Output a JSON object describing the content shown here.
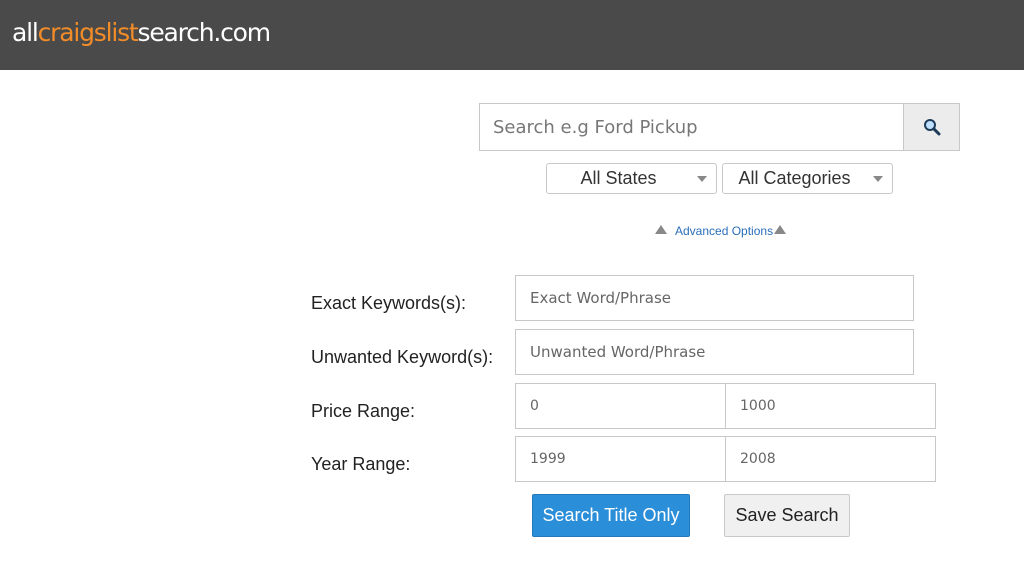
{
  "header": {
    "logo": {
      "part1": "all",
      "part2": "craigslist",
      "part3": "search.com"
    }
  },
  "search": {
    "placeholder": "Search e.g Ford Pickup",
    "button_icon": "magnifier-icon"
  },
  "filters": {
    "states": {
      "selected": "All States"
    },
    "categories": {
      "selected": "All Categories"
    }
  },
  "advanced": {
    "label": "Advanced Options",
    "icon": "triangle-up-icon"
  },
  "form": {
    "exact": {
      "label": "Exact Keywords(s):",
      "placeholder": "Exact Word/Phrase"
    },
    "unwanted": {
      "label": "Unwanted Keyword(s):",
      "placeholder": "Unwanted Word/Phrase"
    },
    "price": {
      "label": "Price Range:",
      "min": "0",
      "max": "1000"
    },
    "year": {
      "label": "Year Range:",
      "min": "1999",
      "max": "2008"
    }
  },
  "actions": {
    "search_title_only": "Search Title Only",
    "save_search": "Save Search"
  },
  "colors": {
    "header_bg": "#4a4a4a",
    "logo_accent": "#f28c28",
    "primary": "#2b8ed8",
    "link": "#2a6ebb"
  }
}
